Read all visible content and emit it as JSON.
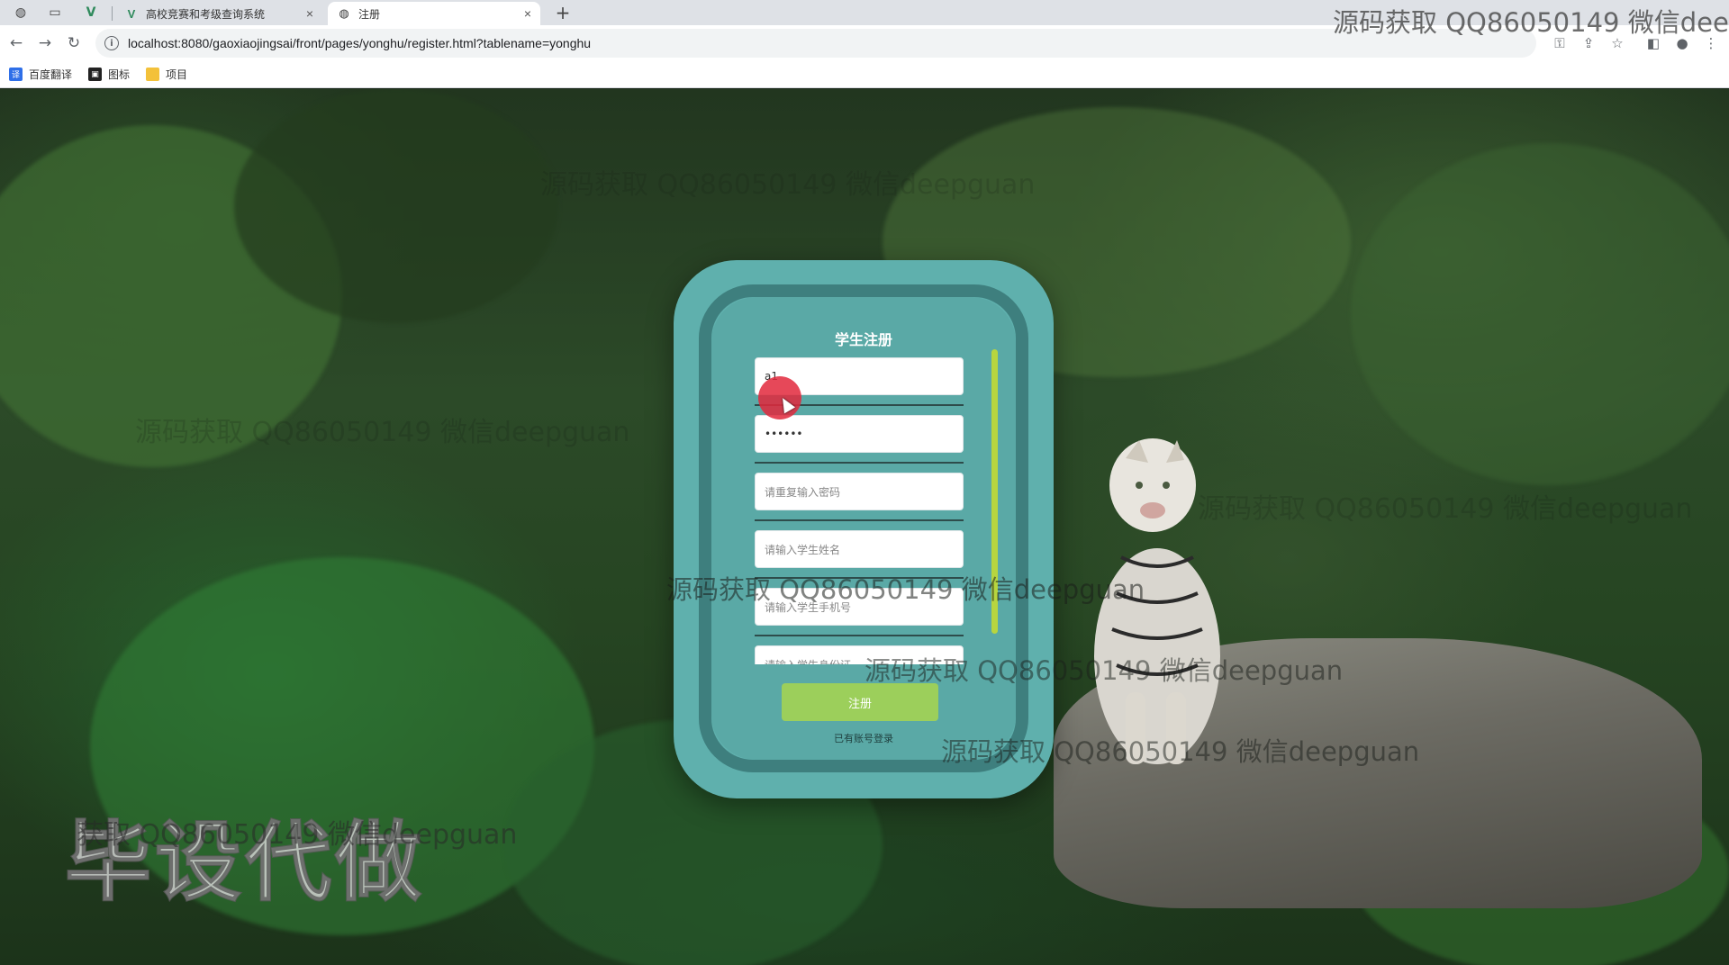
{
  "browser": {
    "tabs": [
      {
        "title": "高校竞赛和考级查询系统",
        "icon": "vue-icon",
        "active": false
      },
      {
        "title": "注册",
        "icon": "globe-icon",
        "active": true
      }
    ],
    "new_tab_symbol": "+",
    "close_symbol": "×",
    "url": "localhost:8080/gaoxiaojingsai/front/pages/yonghu/register.html?tablename=yonghu",
    "bookmarks": [
      {
        "label": "百度翻译",
        "icon": "baidu-translate-icon",
        "color": "#2f6fe8"
      },
      {
        "label": "图标",
        "icon": "image-icon",
        "color": "#222222"
      },
      {
        "label": "项目",
        "icon": "folder-icon",
        "color": "#f3c13a"
      }
    ]
  },
  "watermarks": {
    "top": "源码获取 QQ86050149 微信dee",
    "line": "源码获取 QQ86050149 微信deepguan",
    "big": "毕设代做",
    "big_overlay": "获取 QQ86050149 微信deepguan"
  },
  "register": {
    "title": "学生注册",
    "fields": [
      {
        "value": "a1",
        "placeholder": "",
        "filled": true
      },
      {
        "value": "••••••",
        "placeholder": "",
        "filled": true
      },
      {
        "value": "",
        "placeholder": "请重复输入密码",
        "filled": false
      },
      {
        "value": "",
        "placeholder": "请输入学生姓名",
        "filled": false
      },
      {
        "value": "",
        "placeholder": "请输入学生手机号",
        "filled": false
      },
      {
        "value": "",
        "placeholder": "请输入学生身份证",
        "filled": false
      }
    ],
    "submit_label": "注册",
    "login_link": "已有账号登录"
  },
  "colors": {
    "card": "#5fb0ad",
    "card_ring": "#3e7f7e",
    "submit": "#9ccf5b",
    "scrollbar": "#b7d53f"
  }
}
